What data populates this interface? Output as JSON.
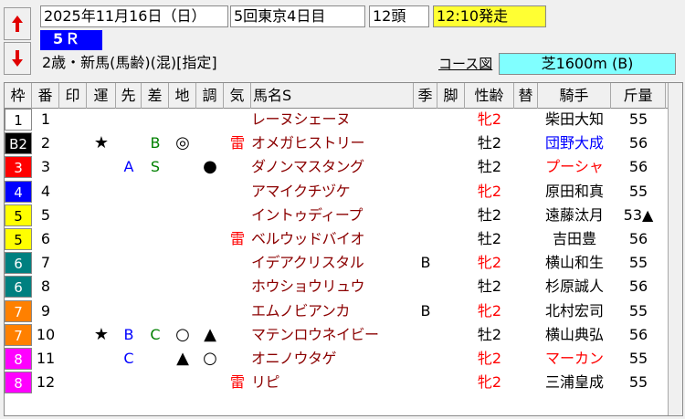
{
  "header": {
    "date": "2025年11月16日（日）",
    "venue": "5回東京4日目",
    "heads": "12頭",
    "post_time": "12:10発走",
    "race_number": "5Ｒ",
    "conditions": "2歳・新馬(馬齢)(混)[指定]",
    "course_link": "コース図",
    "distance": "芝1600m (B)"
  },
  "columns": [
    "枠",
    "番",
    "印",
    "運",
    "先",
    "差",
    "地",
    "調",
    "気",
    "馬名S",
    "季",
    "脚",
    "性齢",
    "替",
    "騎手",
    "斤量"
  ],
  "rows": [
    {
      "waku": "1",
      "waku_bg": "#ffffff",
      "waku_fg": "#000000",
      "num": "1",
      "un": "",
      "saki": "",
      "sa": "",
      "chi": "",
      "cho": "",
      "ki": "",
      "name": "レーヌシェーヌ",
      "season": "",
      "leg": "",
      "sex": "牝2",
      "sex_red": true,
      "kae": "",
      "jockey": "柴田大知",
      "jockey_color": "#000000",
      "weight": "55",
      "weight_mark": ""
    },
    {
      "waku": "B2",
      "waku_bg": "#000000",
      "waku_fg": "#ffffff",
      "num": "2",
      "un": "★",
      "saki": "",
      "sa": "B",
      "chi": "◎",
      "cho": "",
      "ki": "雷",
      "name": "オメガヒストリー",
      "season": "",
      "leg": "",
      "sex": "牡2",
      "sex_red": false,
      "kae": "",
      "jockey": "団野大成",
      "jockey_color": "#0000ff",
      "weight": "56",
      "weight_mark": ""
    },
    {
      "waku": "3",
      "waku_bg": "#ff0000",
      "waku_fg": "#ffffff",
      "num": "3",
      "un": "",
      "saki": "A",
      "sa": "S",
      "chi": "",
      "cho": "●",
      "ki": "",
      "name": "ダノンマスタング",
      "season": "",
      "leg": "",
      "sex": "牡2",
      "sex_red": false,
      "kae": "",
      "jockey": "プーシャ",
      "jockey_color": "#ff0000",
      "weight": "56",
      "weight_mark": ""
    },
    {
      "waku": "4",
      "waku_bg": "#0000ff",
      "waku_fg": "#ffffff",
      "num": "4",
      "un": "",
      "saki": "",
      "sa": "",
      "chi": "",
      "cho": "",
      "ki": "",
      "name": "アマイクチヅケ",
      "season": "",
      "leg": "",
      "sex": "牝2",
      "sex_red": true,
      "kae": "",
      "jockey": "原田和真",
      "jockey_color": "#000000",
      "weight": "55",
      "weight_mark": ""
    },
    {
      "waku": "5",
      "waku_bg": "#ffff00",
      "waku_fg": "#000000",
      "num": "5",
      "un": "",
      "saki": "",
      "sa": "",
      "chi": "",
      "cho": "",
      "ki": "",
      "name": "イントゥディープ",
      "season": "",
      "leg": "",
      "sex": "牡2",
      "sex_red": false,
      "kae": "",
      "jockey": "遠藤汰月",
      "jockey_color": "#000000",
      "weight": "53",
      "weight_mark": "▲"
    },
    {
      "waku": "5",
      "waku_bg": "#ffff00",
      "waku_fg": "#000000",
      "num": "6",
      "un": "",
      "saki": "",
      "sa": "",
      "chi": "",
      "cho": "",
      "ki": "雷",
      "name": "ベルウッドバイオ",
      "season": "",
      "leg": "",
      "sex": "牡2",
      "sex_red": false,
      "kae": "",
      "jockey": "吉田豊",
      "jockey_color": "#000000",
      "weight": "56",
      "weight_mark": ""
    },
    {
      "waku": "6",
      "waku_bg": "#008080",
      "waku_fg": "#ffffff",
      "num": "7",
      "un": "",
      "saki": "",
      "sa": "",
      "chi": "",
      "cho": "",
      "ki": "",
      "name": "イデアクリスタル",
      "season": "B",
      "leg": "",
      "sex": "牝2",
      "sex_red": true,
      "kae": "",
      "jockey": "横山和生",
      "jockey_color": "#000000",
      "weight": "55",
      "weight_mark": ""
    },
    {
      "waku": "6",
      "waku_bg": "#008080",
      "waku_fg": "#ffffff",
      "num": "8",
      "un": "",
      "saki": "",
      "sa": "",
      "chi": "",
      "cho": "",
      "ki": "",
      "name": "ホウショウリュウ",
      "season": "",
      "leg": "",
      "sex": "牡2",
      "sex_red": false,
      "kae": "",
      "jockey": "杉原誠人",
      "jockey_color": "#000000",
      "weight": "56",
      "weight_mark": ""
    },
    {
      "waku": "7",
      "waku_bg": "#ff8000",
      "waku_fg": "#ffffff",
      "num": "9",
      "un": "",
      "saki": "",
      "sa": "",
      "chi": "",
      "cho": "",
      "ki": "",
      "name": "エムノビアンカ",
      "season": "B",
      "leg": "",
      "sex": "牝2",
      "sex_red": true,
      "kae": "",
      "jockey": "北村宏司",
      "jockey_color": "#000000",
      "weight": "55",
      "weight_mark": ""
    },
    {
      "waku": "7",
      "waku_bg": "#ff8000",
      "waku_fg": "#ffffff",
      "num": "10",
      "un": "★",
      "saki": "B",
      "sa": "C",
      "chi": "○",
      "cho": "▲",
      "ki": "",
      "name": "マテンロウネイビー",
      "season": "",
      "leg": "",
      "sex": "牡2",
      "sex_red": false,
      "kae": "",
      "jockey": "横山典弘",
      "jockey_color": "#000000",
      "weight": "56",
      "weight_mark": ""
    },
    {
      "waku": "8",
      "waku_bg": "#ff00ff",
      "waku_fg": "#ffffff",
      "num": "11",
      "un": "",
      "saki": "C",
      "sa": "",
      "chi": "▲",
      "cho": "○",
      "ki": "",
      "name": "オニノウタゲ",
      "season": "",
      "leg": "",
      "sex": "牝2",
      "sex_red": true,
      "kae": "",
      "jockey": "マーカン",
      "jockey_color": "#ff0000",
      "weight": "55",
      "weight_mark": ""
    },
    {
      "waku": "8",
      "waku_bg": "#ff00ff",
      "waku_fg": "#ffffff",
      "num": "12",
      "un": "",
      "saki": "",
      "sa": "",
      "chi": "",
      "cho": "",
      "ki": "雷",
      "name": "リピ",
      "season": "",
      "leg": "",
      "sex": "牝2",
      "sex_red": true,
      "kae": "",
      "jockey": "三浦皇成",
      "jockey_color": "#000000",
      "weight": "55",
      "weight_mark": ""
    }
  ]
}
